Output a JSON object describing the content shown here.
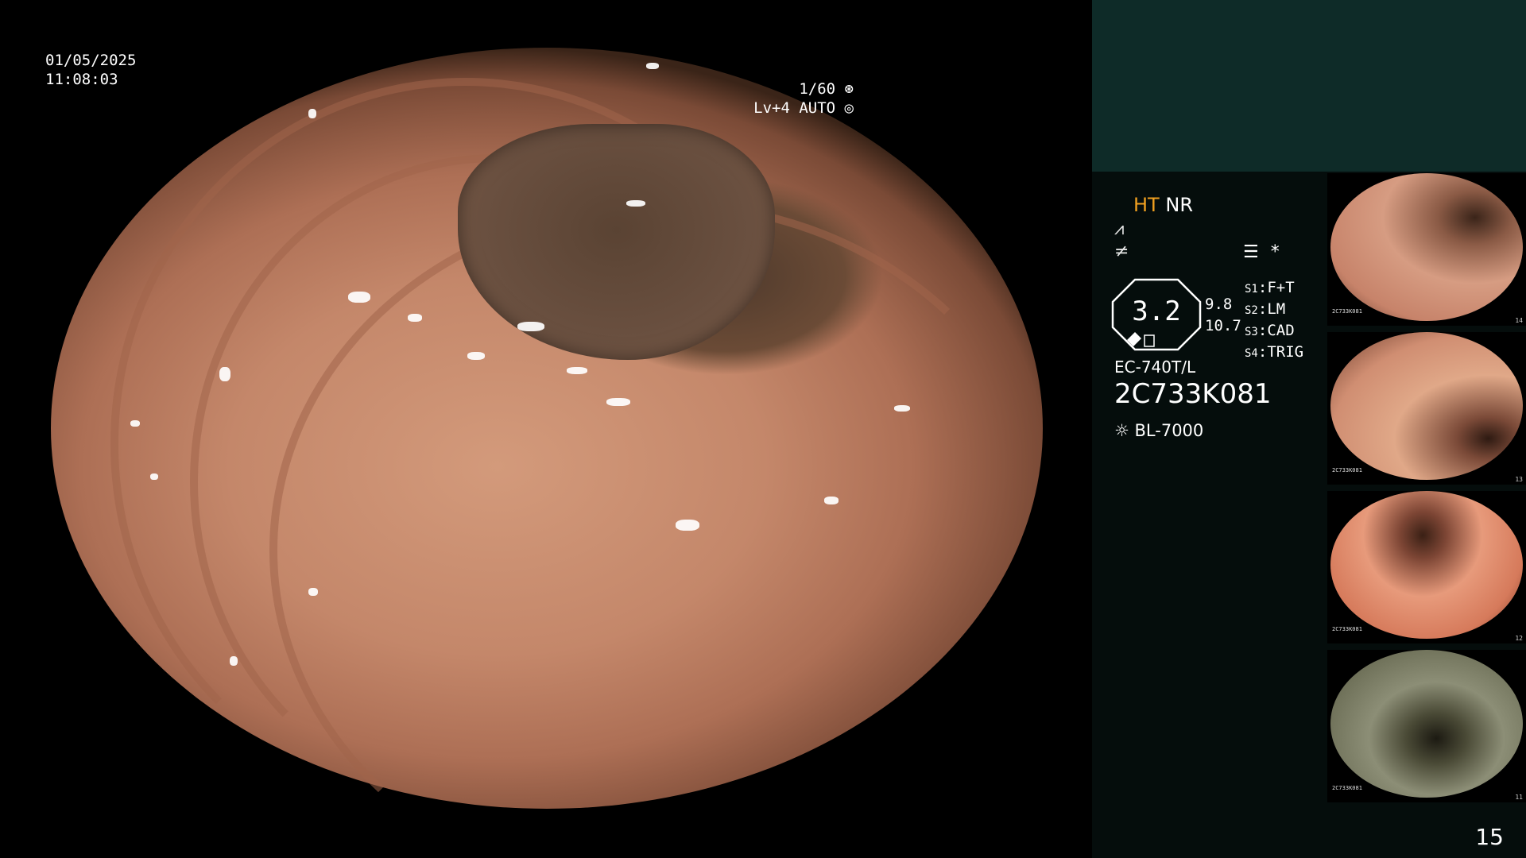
{
  "overlay": {
    "date": "01/05/2025",
    "time": "11:08:03",
    "shutter": "1/60",
    "shutter_icon": "aperture-icon",
    "level": "Lv+4 AUTO",
    "level_icon": "iris-icon"
  },
  "panel": {
    "ht": "HT",
    "nr": "NR",
    "icon1": "⩘",
    "icon2": "≠",
    "menu_glyph": "☰",
    "asterisk": "*",
    "octagon_value": "3.2",
    "side_value_1": "9.8",
    "side_value_2": "10.7",
    "settings": [
      {
        "key": "S1",
        "value": "F+T"
      },
      {
        "key": "S2",
        "value": "LM"
      },
      {
        "key": "S3",
        "value": "CAD"
      },
      {
        "key": "S4",
        "value": "TRIG"
      }
    ],
    "scope_model": "EC-740T/L",
    "serial": "2C733K081",
    "light_source": "BL-7000",
    "page_number": "15"
  },
  "thumbnails": [
    {
      "serial": "2C733K081",
      "index": "14"
    },
    {
      "serial": "2C733K081",
      "index": "13"
    },
    {
      "serial": "2C733K081",
      "index": "12"
    },
    {
      "serial": "2C733K081",
      "index": "11"
    }
  ],
  "colors": {
    "ht_accent": "#f0a020",
    "panel_top": "#0e2b28",
    "panel_bg": "#050d0c"
  }
}
